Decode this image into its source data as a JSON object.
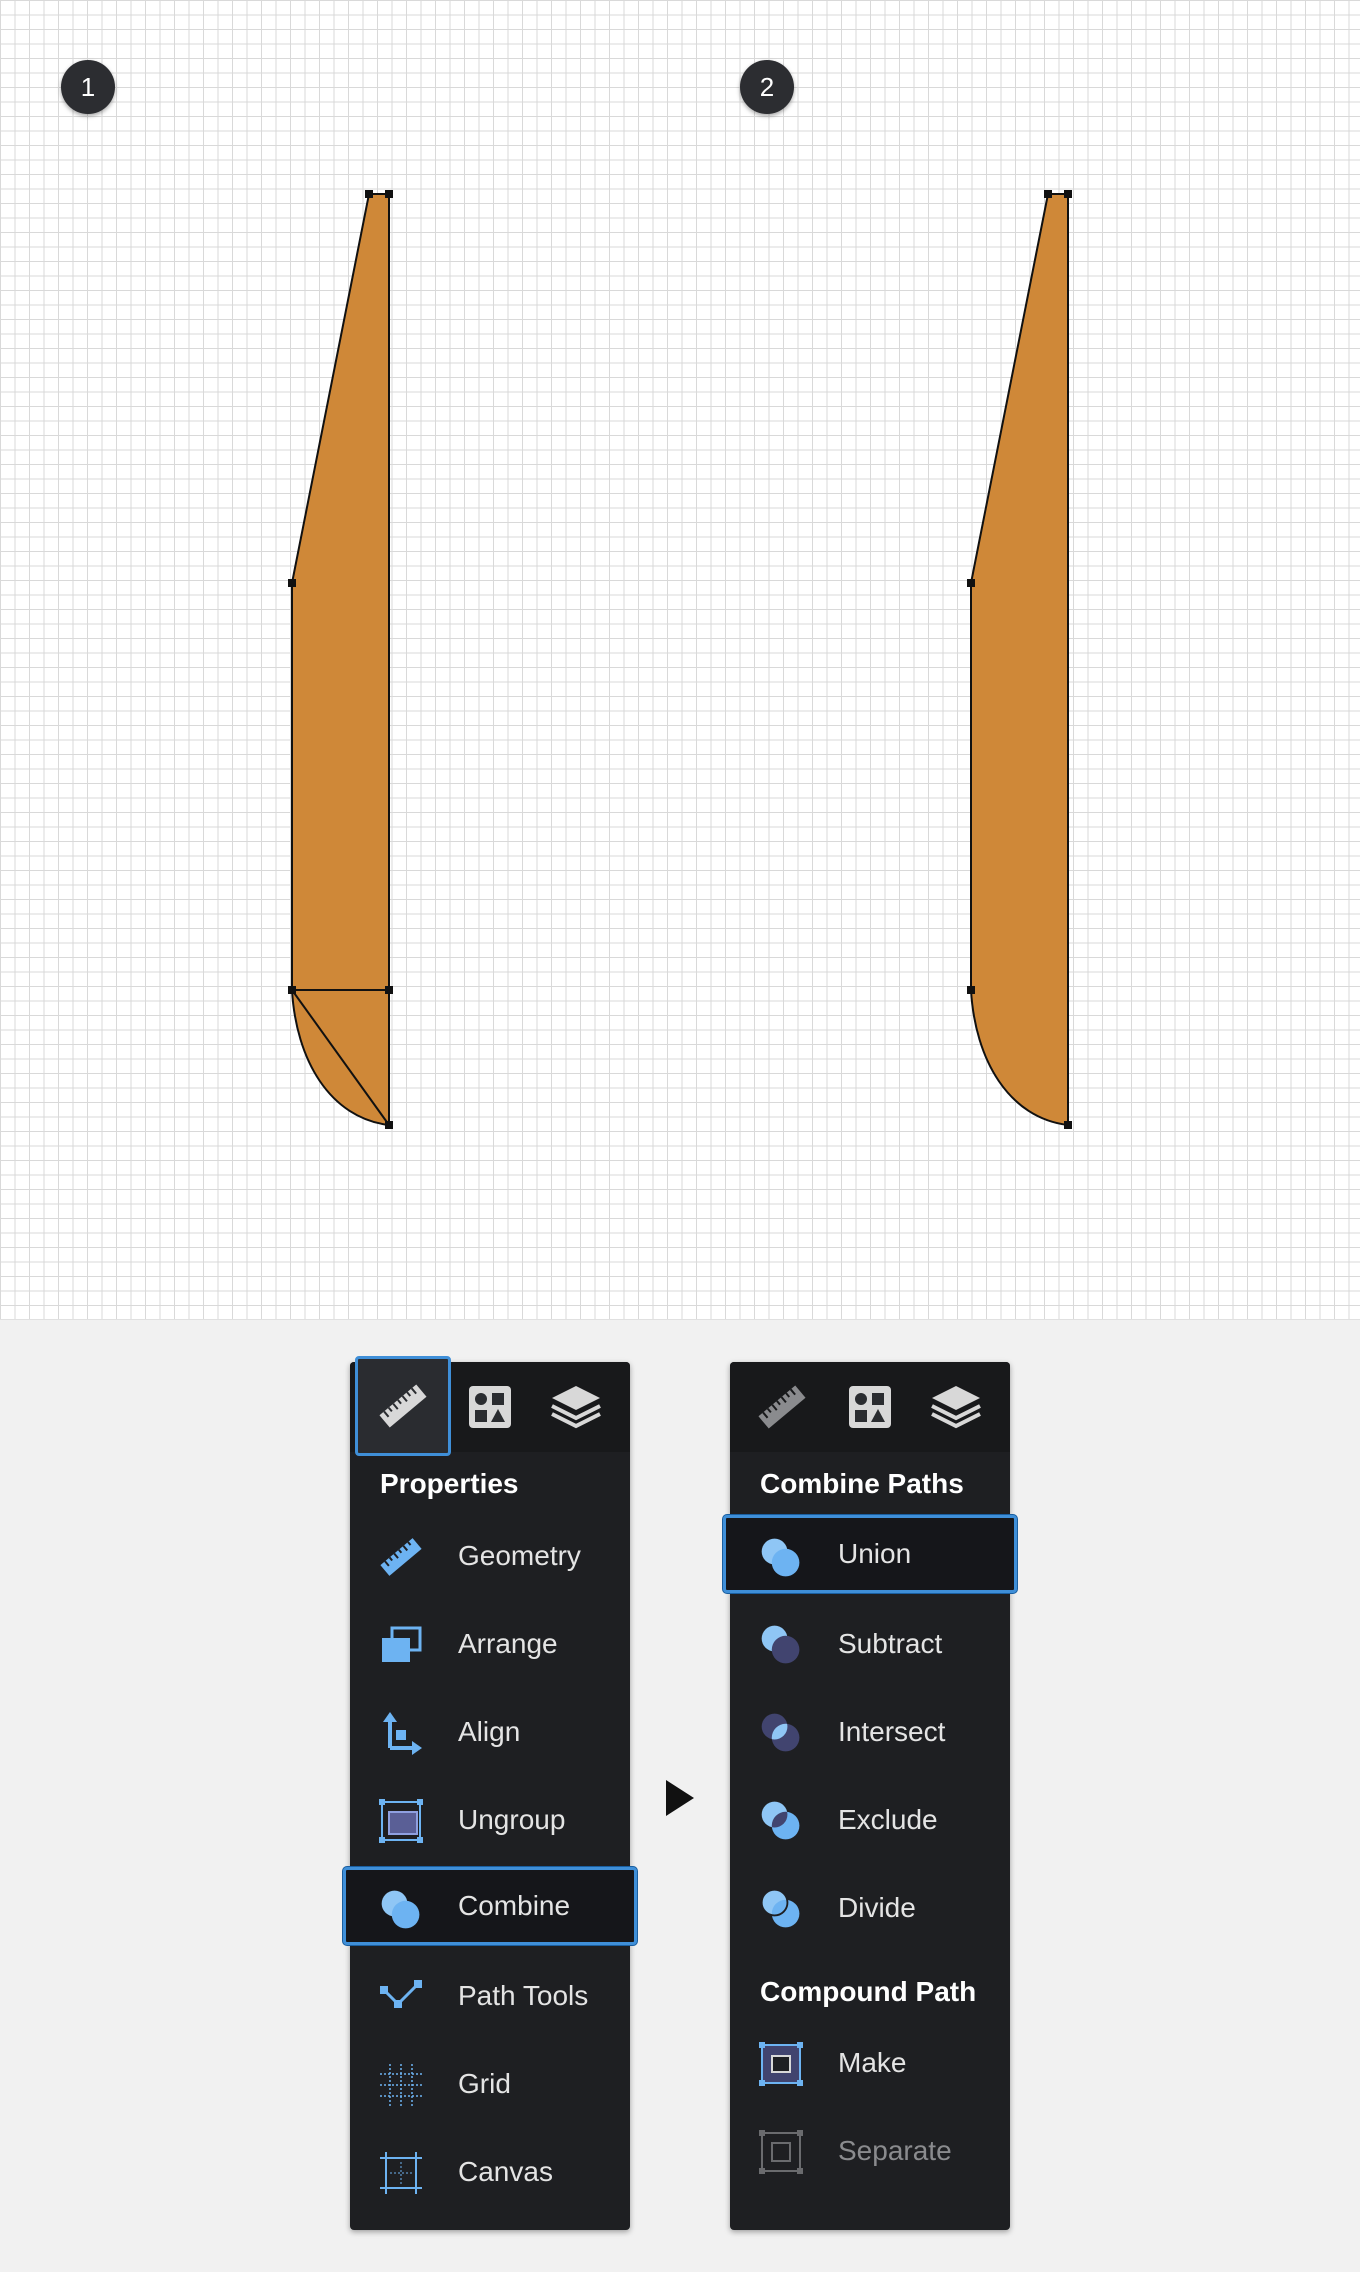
{
  "steps": [
    "1",
    "2"
  ],
  "colors": {
    "shape_fill": "#cf8838",
    "accent": "#3f8fd8",
    "panel_bg": "#1e1f22"
  },
  "left_panel": {
    "tabs": [
      "ruler-icon",
      "shapes-icon",
      "layers-icon"
    ],
    "active_tab": "ruler-icon",
    "header": "Properties",
    "items": [
      {
        "label": "Geometry",
        "icon": "ruler-icon"
      },
      {
        "label": "Arrange",
        "icon": "arrange-icon"
      },
      {
        "label": "Align",
        "icon": "align-icon"
      },
      {
        "label": "Ungroup",
        "icon": "ungroup-icon"
      },
      {
        "label": "Combine",
        "icon": "combine-icon",
        "selected": true
      },
      {
        "label": "Path Tools",
        "icon": "path-tools-icon"
      },
      {
        "label": "Grid",
        "icon": "grid-icon"
      },
      {
        "label": "Canvas",
        "icon": "canvas-icon"
      }
    ]
  },
  "right_panel": {
    "tabs": [
      "ruler-icon",
      "shapes-icon",
      "layers-icon"
    ],
    "header": "Combine Paths",
    "items": [
      {
        "label": "Union",
        "icon": "union-icon",
        "selected": true
      },
      {
        "label": "Subtract",
        "icon": "subtract-icon"
      },
      {
        "label": "Intersect",
        "icon": "intersect-icon"
      },
      {
        "label": "Exclude",
        "icon": "exclude-icon"
      },
      {
        "label": "Divide",
        "icon": "divide-icon"
      }
    ],
    "header2": "Compound Path",
    "items2": [
      {
        "label": "Make",
        "icon": "make-icon"
      },
      {
        "label": "Separate",
        "icon": "separate-icon",
        "disabled": true
      }
    ]
  }
}
